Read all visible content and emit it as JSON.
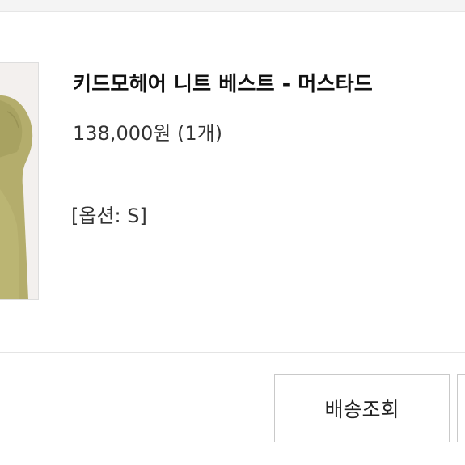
{
  "order_item": {
    "product_name": "키드모헤어 니트 베스트 - 머스타드",
    "price_line": "138,000원 (1개)",
    "option_line": "[옵션: S]"
  },
  "actions": {
    "track_delivery_label": "배송조회",
    "next_button_label": ""
  },
  "colors": {
    "thumbnail_background": "#f3f0ee",
    "product_color": "#b4ad6c",
    "divider": "#e4e4e4",
    "button_border": "#c9c9c9"
  }
}
